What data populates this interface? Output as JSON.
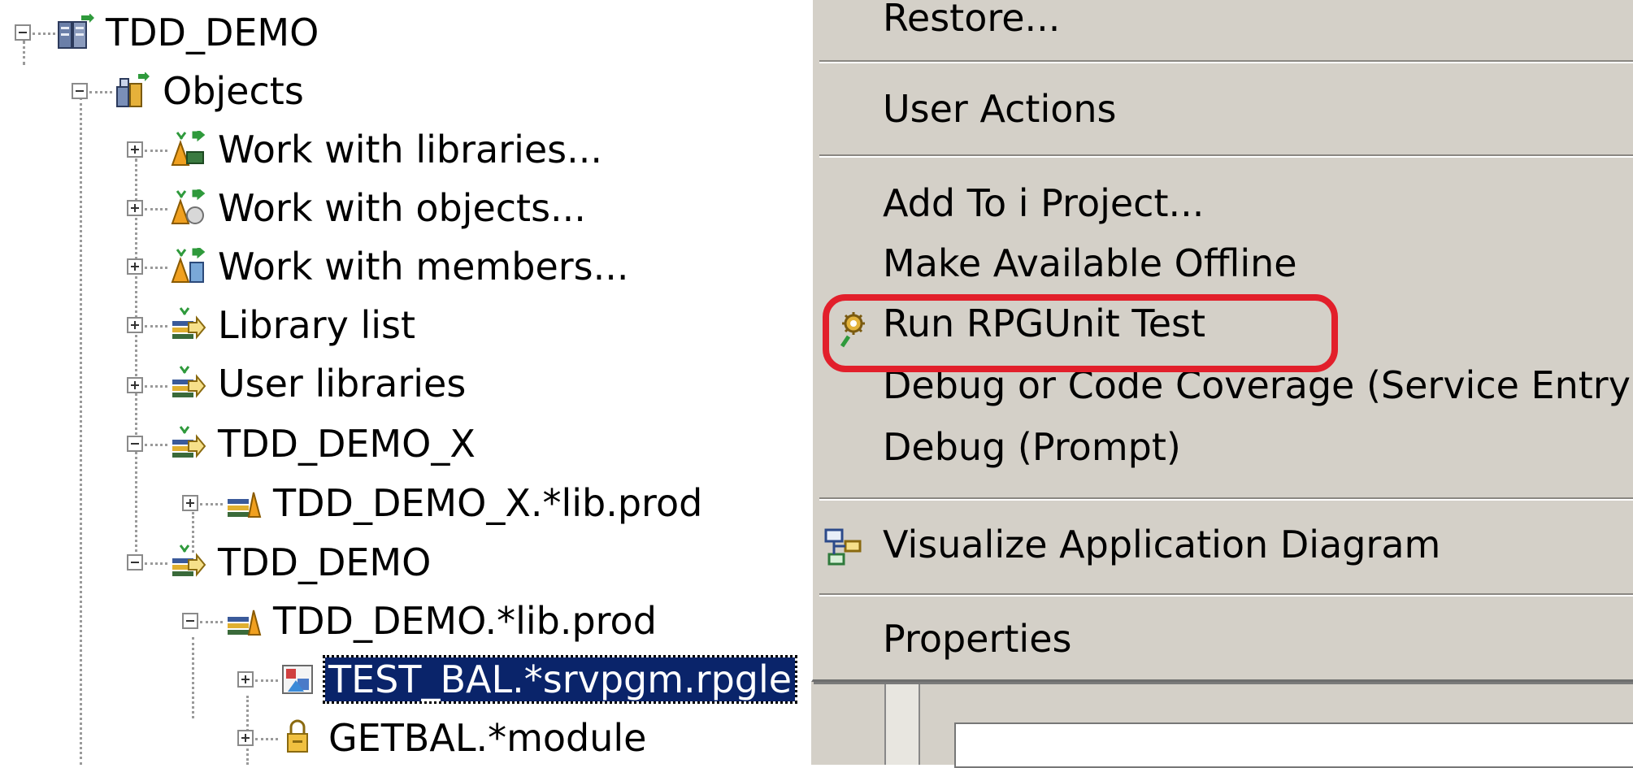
{
  "tree": {
    "root": "TDD_DEMO",
    "objects": "Objects",
    "work_libraries": "Work with libraries...",
    "work_objects": "Work with objects...",
    "work_members": "Work with members...",
    "library_list": "Library list",
    "user_libraries": "User libraries",
    "filter_x": "TDD_DEMO_X",
    "filter_x_lib": "TDD_DEMO_X.*lib.prod",
    "filter": "TDD_DEMO",
    "filter_lib": "TDD_DEMO.*lib.prod",
    "test_bal": "TEST_BAL.*srvpgm.rpgle",
    "getbal": "GETBAL.*module"
  },
  "context_menu": {
    "restore": "Restore...",
    "user_actions": "User Actions",
    "add_to_project": "Add To i Project...",
    "make_offline": "Make Available Offline",
    "run_rpgunit": "Run RPGUnit Test",
    "debug_coverage": "Debug or Code Coverage (Service Entry)",
    "debug_prompt": "Debug (Prompt)",
    "visualize": "Visualize Application Diagram",
    "properties": "Properties"
  },
  "colors": {
    "selection": "#0a246a",
    "menu_background": "#d4d0c8",
    "highlight_ring": "#e21f2b"
  }
}
